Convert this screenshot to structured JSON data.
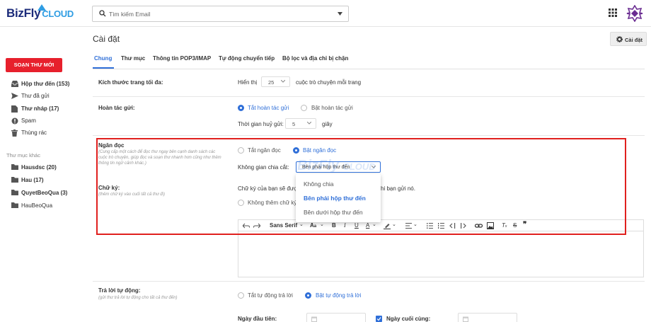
{
  "header": {
    "logo_text_1": "BizFly",
    "logo_text_2": "CLOUD",
    "search_placeholder": "Tìm kiếm Email"
  },
  "page": {
    "title": "Cài đặt",
    "settings_button": "Cài đặt"
  },
  "sidebar": {
    "compose": "SOẠN THƯ MỚI",
    "items": [
      {
        "label": "Hộp thư đến (153)",
        "icon": "inbox-icon"
      },
      {
        "label": "Thư đã gửi",
        "icon": "send-icon"
      },
      {
        "label": "Thư nháp (17)",
        "icon": "draft-icon"
      },
      {
        "label": "Spam",
        "icon": "spam-icon"
      },
      {
        "label": "Thùng rác",
        "icon": "trash-icon"
      }
    ],
    "other_heading": "Thư mục khác",
    "folders": [
      {
        "label": "Hausdsc (20)"
      },
      {
        "label": "Hau (17)"
      },
      {
        "label": "QuyetBeoQua (3)"
      },
      {
        "label": "HauBeoQua"
      }
    ]
  },
  "tabs": [
    "Chung",
    "Thư mục",
    "Thông tin POP3/IMAP",
    "Tự động chuyển tiếp",
    "Bộ lọc và địa chỉ bị chặn"
  ],
  "settings": {
    "page_size": {
      "label": "Kích thước trang tối đa:",
      "prefix": "Hiển thị",
      "value": "25",
      "suffix": "cuộc trò chuyện mỗi trang"
    },
    "undo": {
      "label": "Hoàn tác gửi:",
      "opt_off": "Tắt hoàn tác gửi",
      "opt_on": "Bật hoàn tác gửi",
      "timeout_label": "Thời gian huỷ gửi:",
      "timeout_value": "5",
      "timeout_unit": "giây"
    },
    "reading_pane": {
      "label": "Ngăn đọc",
      "desc": "(Cung cấp một cách để đọc thư ngay bên cạnh danh sách các cuộc trò chuyện, giúp đọc và soạn thư nhanh hơn cũng như thêm thông tin ngữ cảnh khác.)",
      "opt_off": "Tắt ngăn đọc",
      "opt_on": "Bật ngăn đọc",
      "split_label": "Không gian chia cắt:",
      "split_value": "Bên phải hộp thư đến",
      "options": [
        "Không chia",
        "Bên phải hộp thư đến",
        "Bên dưới hộp thư đến"
      ]
    },
    "signature": {
      "label": "Chữ ký:",
      "desc": "(thêm chữ ký vào cuối tất cả thư đi)",
      "info_left": "Chữ ký của bạn sẽ được",
      "info_right": "hi bạn gửi nó.",
      "opt_none": "Không thêm chữ ký",
      "font": "Sans Serif"
    },
    "auto_reply": {
      "label": "Trả lời tự động:",
      "desc": "(gửi thư trả lời tự động cho tất cả thư đến)",
      "opt_off": "Tắt tự động trả lời",
      "opt_on": "Bật tự động trả lời",
      "start_label": "Ngày đầu tiên:",
      "end_label": "Ngày cuối cùng:"
    }
  },
  "watermark": "BizFly CLOUD",
  "colors": {
    "accent": "#2f6fd8",
    "compose": "#e7202c",
    "highlight": "#e0201e"
  }
}
